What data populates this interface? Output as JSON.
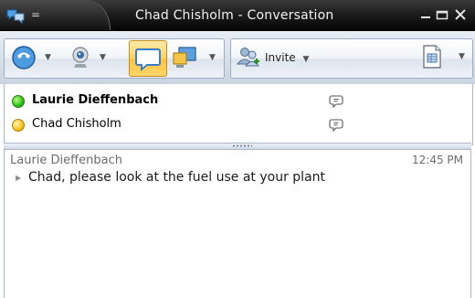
{
  "window": {
    "title": "Chad Chisholm - Conversation",
    "system_menu_glyph": "=",
    "app_icon": "messenger-app-icon",
    "controls": [
      "minimize-icon",
      "maximize-icon",
      "close-icon"
    ]
  },
  "toolbar": {
    "left_group": [
      {
        "name": "phone-call-icon",
        "has_dropdown": true
      },
      {
        "name": "webcam-icon",
        "has_dropdown": true
      },
      {
        "name": "instant-message-icon",
        "active": true
      },
      {
        "name": "share-desktop-icon",
        "has_dropdown": true
      }
    ],
    "invite": {
      "label": "Invite",
      "icon": "invite-people-icon",
      "has_dropdown": true
    },
    "right_icon": {
      "name": "document-options-icon",
      "has_dropdown": true
    },
    "colors": {
      "active_fill": "#ffd363",
      "active_border": "#c98d1e"
    }
  },
  "participants": [
    {
      "name": "Laurie Dieffenbach",
      "status": "available",
      "status_color": "#34c31e",
      "bold": true,
      "icon": "im-bubble-icon"
    },
    {
      "name": "Chad Chisholm",
      "status": "away",
      "status_color": "#ffc726",
      "bold": false,
      "icon": "im-bubble-icon"
    }
  ],
  "conversation": {
    "messages": [
      {
        "sender": "Laurie Dieffenbach",
        "time": "12:45 PM",
        "text": "Chad, please look at the fuel use at your plant"
      }
    ]
  }
}
